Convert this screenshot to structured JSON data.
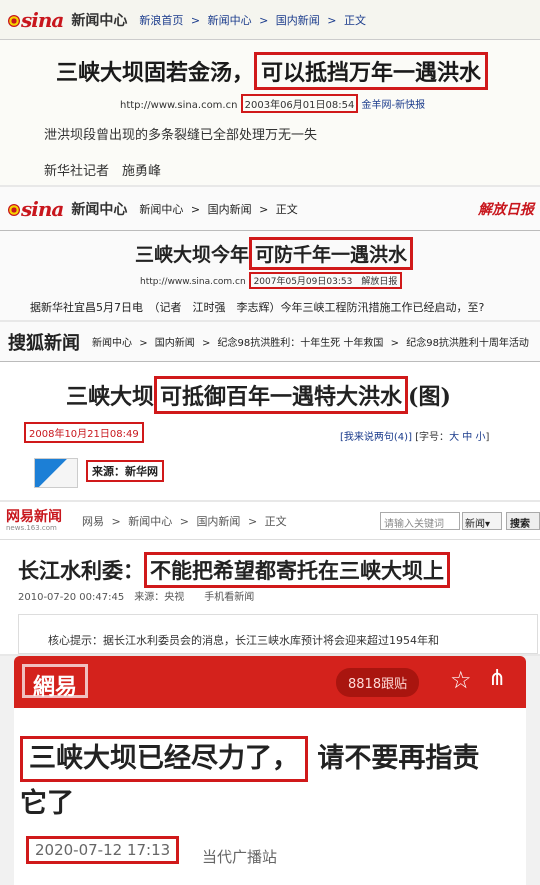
{
  "panel1": {
    "logo": "sina",
    "channel": "新闻中心",
    "crumbs": [
      "新浪首页",
      ">",
      "新闻中心",
      ">",
      "国内新闻",
      ">",
      "正文"
    ],
    "title_plain": "三峡大坝固若金汤，",
    "title_highlight": "可以抵挡万年一遇洪水",
    "url": "http://www.sina.com.cn",
    "datetime": "2003年06月01日08:54",
    "source": "金羊网-新快报",
    "lead": "泄洪坝段曾出现的多条裂缝已全部处理万无一失",
    "byline": "新华社记者　施勇峰"
  },
  "panel2": {
    "logo": "sina",
    "channel": "新闻中心",
    "crumbs": [
      "新闻中心",
      ">",
      "国内新闻",
      ">",
      "正文"
    ],
    "brand_right": "解放日报",
    "title_plain": "三峡大坝今年",
    "title_highlight": "可防千年一遇洪水",
    "url": "http://www.sina.com.cn",
    "datetime_source": "2007年05月09日03:53　解放日报",
    "lead": "据新华社宜昌5月7日电　（记者　江时强　李志辉）今年三峡工程防汛措施工作已经启动，至?"
  },
  "panel3": {
    "logo": "搜狐新闻",
    "crumbs": [
      "新闻中心",
      ">",
      "国内新闻",
      ">",
      "纪念98抗洪胜利：十年生死 十年救国",
      ">",
      "纪念98抗洪胜利十周年活动"
    ],
    "title_plain": "三峡大坝",
    "title_highlight": "可抵御百年一遇特大洪水",
    "title_suffix": "(图)",
    "datetime": "2008年10月21日08:49",
    "tools_link": "[我来说两句(4)]",
    "tools_font": "[字号：",
    "font_sizes": [
      "大",
      "中",
      "小"
    ],
    "tools_end": "]",
    "source": "来源：新华网"
  },
  "panel4": {
    "logo": "网易新闻",
    "logo_sub": "news.163.com",
    "crumbs": [
      "网易",
      ">",
      "新闻中心",
      ">",
      "国内新闻",
      ">",
      "正文"
    ],
    "search_placeholder": "请输入关键词",
    "search_select": "新闻",
    "search_button": "搜索",
    "title_plain": "长江水利委：",
    "title_highlight": "不能把希望都寄托在三峡大坝上",
    "meta": "2010-07-20 00:47:45　来源：央视　　手机看新闻",
    "hint": "核心提示：据长江水利委员会的消息，长江三峡水库预计将会迎来超过1954年和"
  },
  "panel5": {
    "logo": "網易",
    "follow_count": "8818跟贴",
    "title_highlight": "三峡大坝已经尽力了，",
    "title_rest": "请不要再指责它了",
    "datetime": "2020-07-12 17:13",
    "source": "当代广播站",
    "colors": {
      "header": "#d4221c",
      "highlight": "#d0191a"
    }
  }
}
